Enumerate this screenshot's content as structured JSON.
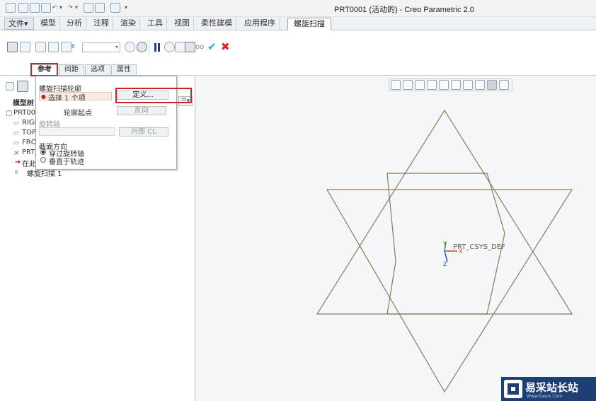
{
  "window": {
    "title": "PRT0001 (活动的) - Creo Parametric 2.0"
  },
  "menu": {
    "tabs": [
      "文件",
      "模型",
      "分析",
      "注释",
      "渲染",
      "工具",
      "视图",
      "柔性建模",
      "应用程序",
      "螺旋扫描"
    ],
    "file_arrow": "▾",
    "active": "螺旋扫描"
  },
  "subtabs": [
    "参考",
    "间距",
    "选项",
    "属性"
  ],
  "popup": {
    "profile_label": "螺旋扫描轮廓",
    "selection_text": "选择 1 个项",
    "define_button": "定义...",
    "start_label": "轮廓起点",
    "reverse_button": "反向",
    "axis_label": "旋转轴",
    "internal_button": "内部 CL",
    "section_label": "截面方向",
    "option_through_axis": "穿过旋转轴",
    "option_normal_traj": "垂直于轨迹"
  },
  "model_tree": {
    "title": "模型树",
    "items": [
      {
        "label": "PRT0001.PRT",
        "icon": "part-icon"
      },
      {
        "label": "RIGHT",
        "icon": "datum-plane-icon"
      },
      {
        "label": "TOP",
        "icon": "datum-plane-icon"
      },
      {
        "label": "FRONT",
        "icon": "datum-plane-icon"
      },
      {
        "label": "PRT_CSYS_DEF",
        "icon": "csys-icon"
      },
      {
        "label": "在此插入",
        "icon": "insert-arrow-icon"
      },
      {
        "label": "螺旋扫描 1",
        "icon": "helical-sweep-icon"
      }
    ]
  },
  "graphics": {
    "csys_label": "PRT_CSYS_DEF",
    "axis_x": "X",
    "axis_y": "Y",
    "axis_z": "Z",
    "line_color": "#8b7a5a"
  },
  "watermark": {
    "brand": "易采站长站",
    "url": "Www.Easck.Com"
  },
  "colors": {
    "highlight_red": "#cc2222",
    "ok_blue": "#2fa6d6",
    "cancel_red": "#d22222"
  }
}
